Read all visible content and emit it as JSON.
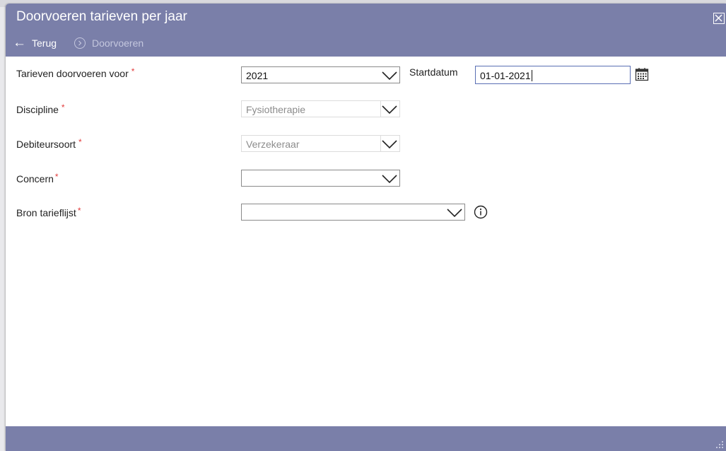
{
  "window": {
    "title": "Doorvoeren tarieven per jaar"
  },
  "toolbar": {
    "back_label": "Terug",
    "forward_label": "Doorvoeren"
  },
  "form": {
    "required_mark": "*",
    "rows": [
      {
        "label": "Tarieven doorvoeren voor",
        "value": "2021"
      },
      {
        "label": "Discipline",
        "value": "Fysiotherapie"
      },
      {
        "label": "Debiteursoort",
        "value": "Verzekeraar"
      },
      {
        "label": "Concern",
        "value": ""
      },
      {
        "label": "Bron tarieflijst",
        "value": ""
      }
    ],
    "startdatum": {
      "label": "Startdatum",
      "value": "01-01-2021"
    }
  },
  "colors": {
    "header_bg": "#7a7fa9",
    "required": "#e23b3b",
    "input_focus_border": "#5a6fb4"
  }
}
